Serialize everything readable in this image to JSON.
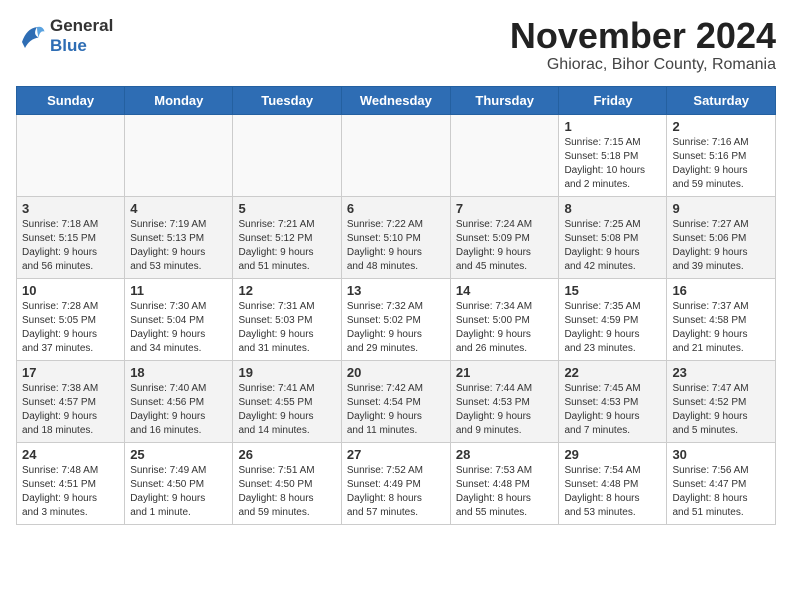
{
  "logo": {
    "line1": "General",
    "line2": "Blue"
  },
  "title": "November 2024",
  "location": "Ghiorac, Bihor County, Romania",
  "weekdays": [
    "Sunday",
    "Monday",
    "Tuesday",
    "Wednesday",
    "Thursday",
    "Friday",
    "Saturday"
  ],
  "weeks": [
    [
      {
        "day": "",
        "info": ""
      },
      {
        "day": "",
        "info": ""
      },
      {
        "day": "",
        "info": ""
      },
      {
        "day": "",
        "info": ""
      },
      {
        "day": "",
        "info": ""
      },
      {
        "day": "1",
        "info": "Sunrise: 7:15 AM\nSunset: 5:18 PM\nDaylight: 10 hours\nand 2 minutes."
      },
      {
        "day": "2",
        "info": "Sunrise: 7:16 AM\nSunset: 5:16 PM\nDaylight: 9 hours\nand 59 minutes."
      }
    ],
    [
      {
        "day": "3",
        "info": "Sunrise: 7:18 AM\nSunset: 5:15 PM\nDaylight: 9 hours\nand 56 minutes."
      },
      {
        "day": "4",
        "info": "Sunrise: 7:19 AM\nSunset: 5:13 PM\nDaylight: 9 hours\nand 53 minutes."
      },
      {
        "day": "5",
        "info": "Sunrise: 7:21 AM\nSunset: 5:12 PM\nDaylight: 9 hours\nand 51 minutes."
      },
      {
        "day": "6",
        "info": "Sunrise: 7:22 AM\nSunset: 5:10 PM\nDaylight: 9 hours\nand 48 minutes."
      },
      {
        "day": "7",
        "info": "Sunrise: 7:24 AM\nSunset: 5:09 PM\nDaylight: 9 hours\nand 45 minutes."
      },
      {
        "day": "8",
        "info": "Sunrise: 7:25 AM\nSunset: 5:08 PM\nDaylight: 9 hours\nand 42 minutes."
      },
      {
        "day": "9",
        "info": "Sunrise: 7:27 AM\nSunset: 5:06 PM\nDaylight: 9 hours\nand 39 minutes."
      }
    ],
    [
      {
        "day": "10",
        "info": "Sunrise: 7:28 AM\nSunset: 5:05 PM\nDaylight: 9 hours\nand 37 minutes."
      },
      {
        "day": "11",
        "info": "Sunrise: 7:30 AM\nSunset: 5:04 PM\nDaylight: 9 hours\nand 34 minutes."
      },
      {
        "day": "12",
        "info": "Sunrise: 7:31 AM\nSunset: 5:03 PM\nDaylight: 9 hours\nand 31 minutes."
      },
      {
        "day": "13",
        "info": "Sunrise: 7:32 AM\nSunset: 5:02 PM\nDaylight: 9 hours\nand 29 minutes."
      },
      {
        "day": "14",
        "info": "Sunrise: 7:34 AM\nSunset: 5:00 PM\nDaylight: 9 hours\nand 26 minutes."
      },
      {
        "day": "15",
        "info": "Sunrise: 7:35 AM\nSunset: 4:59 PM\nDaylight: 9 hours\nand 23 minutes."
      },
      {
        "day": "16",
        "info": "Sunrise: 7:37 AM\nSunset: 4:58 PM\nDaylight: 9 hours\nand 21 minutes."
      }
    ],
    [
      {
        "day": "17",
        "info": "Sunrise: 7:38 AM\nSunset: 4:57 PM\nDaylight: 9 hours\nand 18 minutes."
      },
      {
        "day": "18",
        "info": "Sunrise: 7:40 AM\nSunset: 4:56 PM\nDaylight: 9 hours\nand 16 minutes."
      },
      {
        "day": "19",
        "info": "Sunrise: 7:41 AM\nSunset: 4:55 PM\nDaylight: 9 hours\nand 14 minutes."
      },
      {
        "day": "20",
        "info": "Sunrise: 7:42 AM\nSunset: 4:54 PM\nDaylight: 9 hours\nand 11 minutes."
      },
      {
        "day": "21",
        "info": "Sunrise: 7:44 AM\nSunset: 4:53 PM\nDaylight: 9 hours\nand 9 minutes."
      },
      {
        "day": "22",
        "info": "Sunrise: 7:45 AM\nSunset: 4:53 PM\nDaylight: 9 hours\nand 7 minutes."
      },
      {
        "day": "23",
        "info": "Sunrise: 7:47 AM\nSunset: 4:52 PM\nDaylight: 9 hours\nand 5 minutes."
      }
    ],
    [
      {
        "day": "24",
        "info": "Sunrise: 7:48 AM\nSunset: 4:51 PM\nDaylight: 9 hours\nand 3 minutes."
      },
      {
        "day": "25",
        "info": "Sunrise: 7:49 AM\nSunset: 4:50 PM\nDaylight: 9 hours\nand 1 minute."
      },
      {
        "day": "26",
        "info": "Sunrise: 7:51 AM\nSunset: 4:50 PM\nDaylight: 8 hours\nand 59 minutes."
      },
      {
        "day": "27",
        "info": "Sunrise: 7:52 AM\nSunset: 4:49 PM\nDaylight: 8 hours\nand 57 minutes."
      },
      {
        "day": "28",
        "info": "Sunrise: 7:53 AM\nSunset: 4:48 PM\nDaylight: 8 hours\nand 55 minutes."
      },
      {
        "day": "29",
        "info": "Sunrise: 7:54 AM\nSunset: 4:48 PM\nDaylight: 8 hours\nand 53 minutes."
      },
      {
        "day": "30",
        "info": "Sunrise: 7:56 AM\nSunset: 4:47 PM\nDaylight: 8 hours\nand 51 minutes."
      }
    ]
  ]
}
